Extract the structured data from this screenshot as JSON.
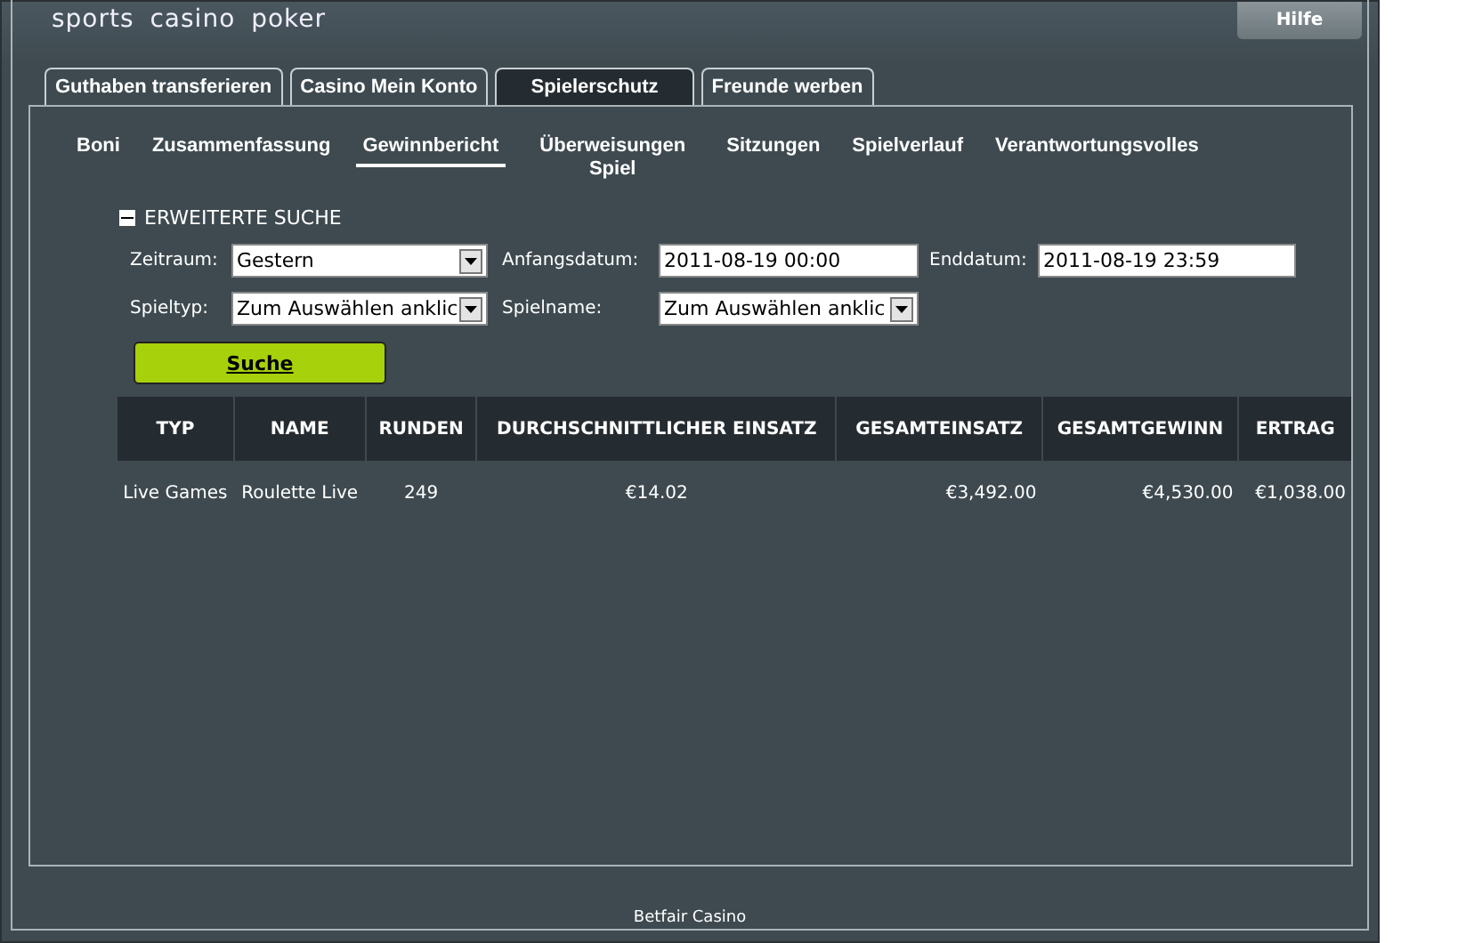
{
  "brand": "sports casino poker",
  "help_button": "Hilfe",
  "tabs": [
    {
      "label": "Guthaben transferieren",
      "selected": false
    },
    {
      "label": "Casino Mein Konto",
      "selected": false
    },
    {
      "label": "Spielerschutz",
      "selected": true
    },
    {
      "label": "Freunde werben",
      "selected": false
    }
  ],
  "subtabs": [
    {
      "label": "Boni",
      "selected": false
    },
    {
      "label": "Zusammenfassung",
      "selected": false
    },
    {
      "label": "Gewinnbericht",
      "selected": true
    },
    {
      "label": "Überweisungen Spiel",
      "selected": false
    },
    {
      "label": "Sitzungen",
      "selected": false
    },
    {
      "label": "Spielverlauf",
      "selected": false
    },
    {
      "label": "Verantwortungsvolles",
      "selected": false
    }
  ],
  "search": {
    "title": "ERWEITERTE SUCHE",
    "expanded": true,
    "fields": [
      {
        "label": "Zeitraum:",
        "kind": "select",
        "value": "Gestern"
      },
      {
        "label": "Anfangsdatum:",
        "kind": "text",
        "value": "2011-08-19 00:00"
      },
      {
        "label": "Enddatum:",
        "kind": "text",
        "value": "2011-08-19 23:59"
      },
      {
        "label": "Spieltyp:",
        "kind": "select",
        "value": "Zum Auswählen anklic"
      },
      {
        "label": "Spielname:",
        "kind": "select",
        "value": "Zum Auswählen anklic"
      }
    ],
    "button": "Suche"
  },
  "table": {
    "columns": [
      "TYP",
      "NAME",
      "RUNDEN",
      "DURCHSCHNITTLICHER EINSATZ",
      "GESAMTEINSATZ",
      "GESAMTGEWINN",
      "ERTRAG"
    ],
    "rows": [
      [
        "Live Games",
        "Roulette Live",
        "249",
        "€14.02",
        "€3,492.00",
        "€4,530.00",
        "€1,038.00"
      ]
    ]
  },
  "footer": "Betfair Casino"
}
